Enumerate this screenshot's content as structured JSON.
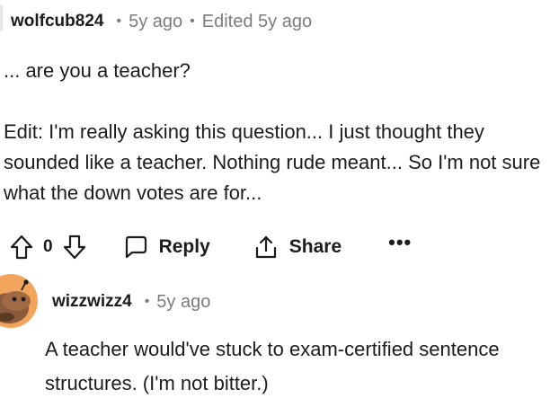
{
  "comment": {
    "username": "wolfcub824",
    "separator": "•",
    "time": "5y ago",
    "edited": "Edited 5y ago",
    "body_line1": "... are you a teacher?",
    "body_edit": "Edit: I'm really asking this question... I just thought they sounded like a teacher. Nothing rude meant... So I'm not sure what the down votes are for..."
  },
  "actions": {
    "upvote_icon": "upvote-arrow-icon",
    "vote_count": "0",
    "downvote_icon": "downvote-arrow-icon",
    "reply_label": "Reply",
    "reply_icon": "speech-bubble-icon",
    "share_label": "Share",
    "share_icon": "share-arrow-icon",
    "more_label": "•••"
  },
  "reply": {
    "avatar_icon": "snoo-avatar-icon",
    "avatar_color": "#f2a45c",
    "username": "wizzwizz4",
    "separator": "•",
    "time": "5y ago",
    "body": "A teacher would've stuck to exam-certified sentence structures. (I'm not bitter.)"
  }
}
